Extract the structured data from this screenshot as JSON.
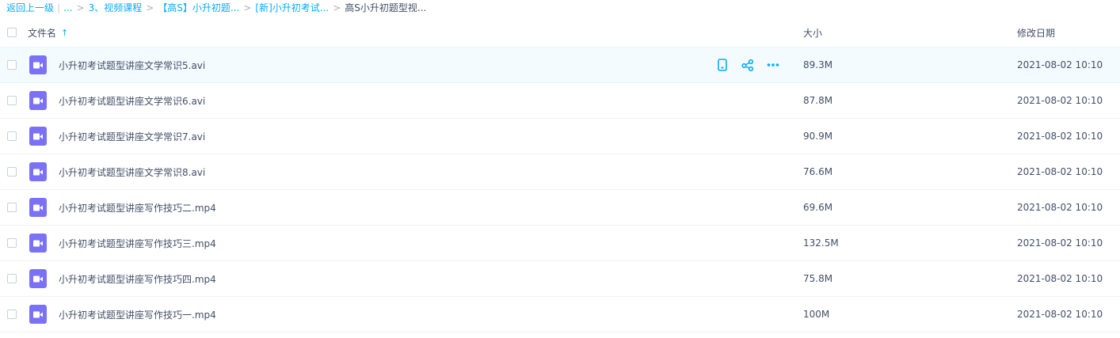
{
  "breadcrumb": {
    "back": "返回上一级",
    "sep": "|",
    "ellipsis": "...",
    "arrow": ">",
    "items": [
      "3、视频课程",
      "【高S】小升初题...",
      "[新]小升初考试..."
    ],
    "current": "高S小升初题型视..."
  },
  "header": {
    "name": "文件名",
    "sort_arrow": "↑",
    "size": "大小",
    "date": "修改日期"
  },
  "colors": {
    "accent": "#09aaff",
    "video_icon": "#7b71f6",
    "hover_row": "#f4fbff"
  },
  "files": [
    {
      "name": "小升初考试题型讲座文学常识5.avi",
      "size": "89.3M",
      "date": "2021-08-02 10:10",
      "icon": "video-file-icon"
    },
    {
      "name": "小升初考试题型讲座文学常识6.avi",
      "size": "87.8M",
      "date": "2021-08-02 10:10",
      "icon": "video-file-icon"
    },
    {
      "name": "小升初考试题型讲座文学常识7.avi",
      "size": "90.9M",
      "date": "2021-08-02 10:10",
      "icon": "video-file-icon"
    },
    {
      "name": "小升初考试题型讲座文学常识8.avi",
      "size": "76.6M",
      "date": "2021-08-02 10:10",
      "icon": "video-file-icon"
    },
    {
      "name": "小升初考试题型讲座写作技巧二.mp4",
      "size": "69.6M",
      "date": "2021-08-02 10:10",
      "icon": "video-file-icon"
    },
    {
      "name": "小升初考试题型讲座写作技巧三.mp4",
      "size": "132.5M",
      "date": "2021-08-02 10:10",
      "icon": "video-file-icon"
    },
    {
      "name": "小升初考试题型讲座写作技巧四.mp4",
      "size": "75.8M",
      "date": "2021-08-02 10:10",
      "icon": "video-file-icon"
    },
    {
      "name": "小升初考试题型讲座写作技巧一.mp4",
      "size": "100M",
      "date": "2021-08-02 10:10",
      "icon": "video-file-icon"
    }
  ],
  "row_actions": [
    "phone-icon",
    "share-icon",
    "more-icon"
  ]
}
